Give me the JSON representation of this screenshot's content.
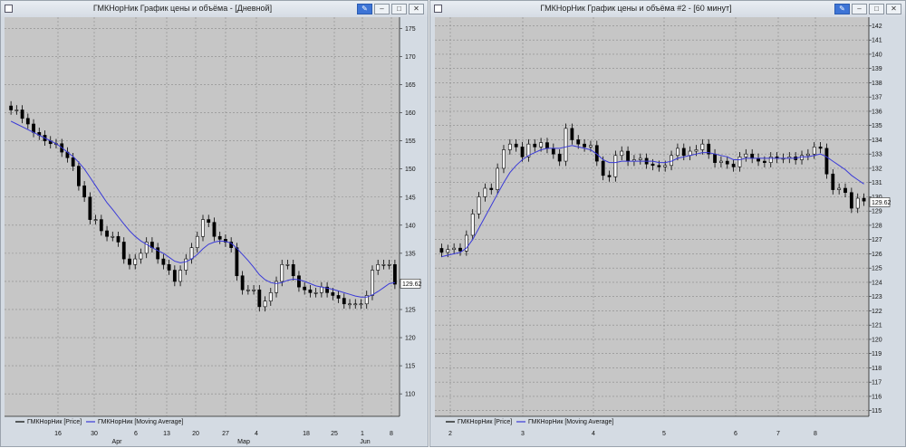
{
  "windows": {
    "left": {
      "title": "ГМКНорНик График цены и объёма - [Дневной]"
    },
    "right": {
      "title": "ГМКНорНик График цены и объёма #2 - [60 минут]"
    }
  },
  "window_buttons": {
    "pin": "pin-icon",
    "minimize": "minimize-icon",
    "maximize": "maximize-icon",
    "close": "close-icon"
  },
  "colors": {
    "background": "#c6c6c6",
    "candle": "#000000",
    "moving_average": "#3a3ad8",
    "grid": "#8a8a8a",
    "window_chrome": "#d4dbe3"
  },
  "chart_data": [
    {
      "type": "candlestick",
      "timeframe": "Дневной",
      "ylim": [
        106,
        177
      ],
      "yticks": [
        110,
        115,
        120,
        125,
        130,
        135,
        140,
        145,
        150,
        155,
        160,
        165,
        170,
        175
      ],
      "x_day_labels": [
        "16",
        "30",
        "6",
        "13",
        "20",
        "27",
        "4",
        "18",
        "25",
        "1",
        "8"
      ],
      "x_month_labels": [
        "Apr",
        "Мар",
        "Jun"
      ],
      "last_price_label": "129.62",
      "grid": true,
      "legend": [
        {
          "label": "ГМКНорНик [Price]",
          "color": "#000000"
        },
        {
          "label": "ГМКНорНик [Moving Average]",
          "color": "#3a3ad8"
        }
      ],
      "closes": [
        160.5,
        160.5,
        159,
        158,
        156.5,
        156,
        155,
        154.5,
        154.5,
        153,
        152,
        150.5,
        147,
        145,
        141,
        141,
        139,
        138,
        138,
        137,
        134,
        133,
        134,
        135,
        137,
        136,
        134,
        133,
        132,
        130,
        132,
        134,
        136,
        138,
        141,
        140.5,
        138,
        137.5,
        137,
        136,
        131,
        128.5,
        128.5,
        128.5,
        125.5,
        126.5,
        128,
        130,
        133,
        133,
        131,
        129,
        128.5,
        128,
        128,
        129,
        128,
        127.5,
        127,
        126,
        126,
        126,
        126,
        127.5,
        132,
        133,
        133,
        133,
        129.5
      ],
      "ma": [
        158.5,
        158,
        157.5,
        157,
        156.5,
        156,
        155.5,
        155,
        154.5,
        153.8,
        153,
        152.2,
        151.2,
        150,
        148.5,
        147,
        145.5,
        144,
        142.8,
        141.5,
        140.2,
        139,
        138,
        137.2,
        136.6,
        136,
        135.5,
        135,
        134.3,
        133.6,
        133.3,
        133.5,
        134,
        134.8,
        135.8,
        136.6,
        137,
        137.2,
        137.1,
        136.8,
        135.9,
        134.8,
        133.7,
        132.5,
        131.2,
        130.3,
        129.8,
        129.6,
        129.8,
        130.2,
        130.4,
        130.3,
        130,
        129.6,
        129.2,
        129,
        128.8,
        128.6,
        128.3,
        128,
        127.7,
        127.4,
        127.2,
        127.2,
        127.6,
        128.2,
        128.9,
        129.6,
        129.8
      ]
    },
    {
      "type": "candlestick",
      "timeframe": "60 минут",
      "ylim": [
        114.6,
        142.6
      ],
      "yticks": [
        115,
        116,
        117,
        118,
        119,
        120,
        121,
        122,
        123,
        124,
        125,
        126,
        127,
        128,
        129,
        130,
        131,
        132,
        133,
        134,
        135,
        136,
        137,
        138,
        139,
        140,
        141,
        142
      ],
      "x_day_labels": [
        "2",
        "3",
        "4",
        "5",
        "6",
        "7",
        "8"
      ],
      "last_price_label": "129.62",
      "grid": true,
      "legend": [
        {
          "label": "ГМКНорНик [Price]",
          "color": "#000000"
        },
        {
          "label": "ГМКНорНик [Moving Average]",
          "color": "#3a3ad8"
        }
      ],
      "closes": [
        126.1,
        126.3,
        126.4,
        126.2,
        127.3,
        128.8,
        130,
        130.6,
        130.5,
        132,
        133.3,
        133.7,
        133.5,
        132.8,
        133.7,
        133.5,
        133.8,
        133.4,
        133,
        132.5,
        134.8,
        134,
        133.7,
        133.5,
        133.6,
        132.5,
        131.5,
        131.4,
        132.9,
        133.2,
        132.5,
        132.6,
        132.7,
        132.3,
        132.2,
        132.1,
        132.2,
        132.9,
        133.4,
        132.9,
        133.2,
        133.3,
        133.7,
        133,
        132.4,
        132.5,
        132.3,
        132.1,
        132.8,
        133,
        132.7,
        132.5,
        132.4,
        132.8,
        132.7,
        132.7,
        132.8,
        132.6,
        132.9,
        133,
        133.5,
        133.4,
        131.6,
        130.5,
        130.6,
        130.3,
        129.2,
        129.9,
        129.7
      ],
      "ma": [
        125.8,
        125.9,
        126,
        126.1,
        126.4,
        127,
        127.8,
        128.6,
        129.4,
        130.2,
        131,
        131.7,
        132.2,
        132.6,
        132.9,
        133.1,
        133.3,
        133.4,
        133.4,
        133.4,
        133.5,
        133.6,
        133.5,
        133.4,
        133.3,
        133,
        132.6,
        132.4,
        132.4,
        132.5,
        132.5,
        132.5,
        132.5,
        132.5,
        132.5,
        132.4,
        132.4,
        132.5,
        132.7,
        132.8,
        132.9,
        133,
        133.1,
        133.1,
        133,
        132.9,
        132.8,
        132.6,
        132.6,
        132.7,
        132.7,
        132.7,
        132.7,
        132.7,
        132.7,
        132.7,
        132.7,
        132.7,
        132.8,
        132.8,
        132.9,
        133,
        132.8,
        132.5,
        132.2,
        131.9,
        131.5,
        131.2,
        130.9
      ]
    }
  ]
}
